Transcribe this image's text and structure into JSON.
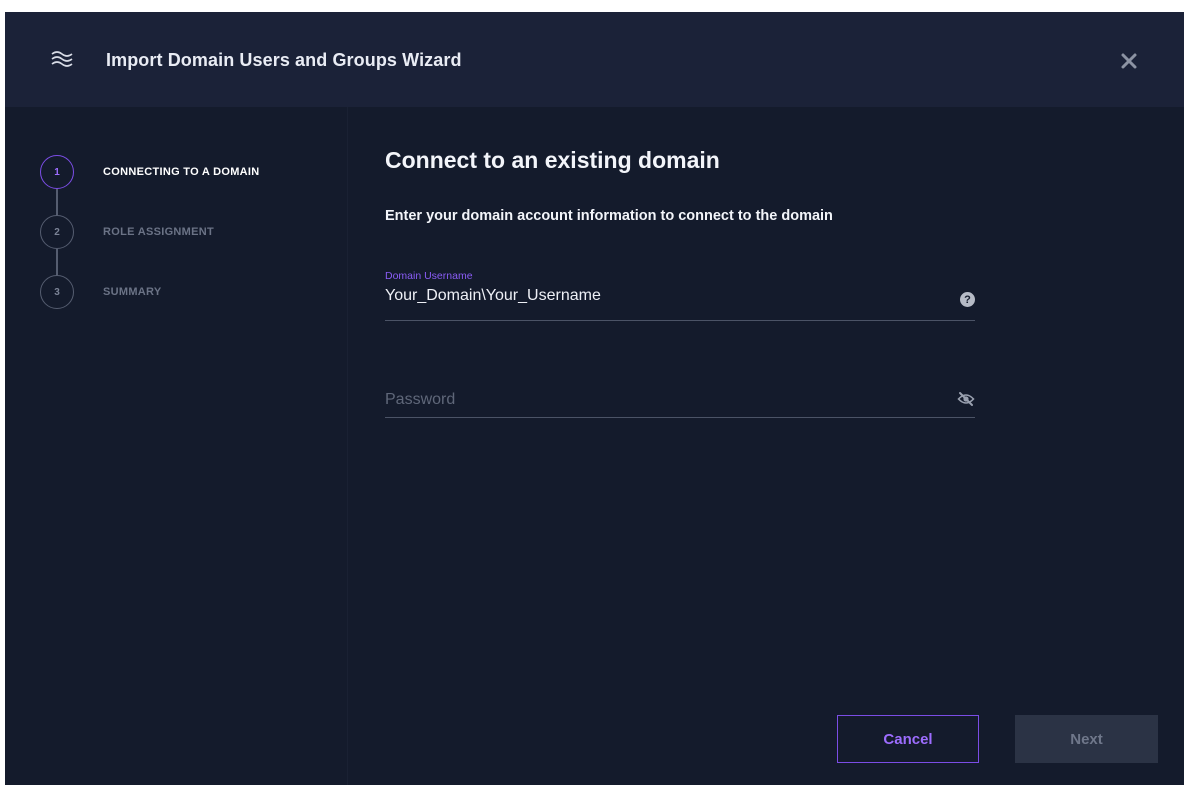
{
  "window": {
    "title": "Import Domain Users and Groups Wizard",
    "logo_icon": "waves-icon",
    "close_icon": "close-icon"
  },
  "steps": [
    {
      "number": "1",
      "label": "CONNECTING TO A DOMAIN",
      "active": true
    },
    {
      "number": "2",
      "label": "ROLE ASSIGNMENT",
      "active": false
    },
    {
      "number": "3",
      "label": "SUMMARY",
      "active": false
    }
  ],
  "main": {
    "heading": "Connect to an existing domain",
    "subheading": "Enter your domain account information to connect to the domain",
    "username": {
      "label": "Domain Username",
      "value": "Your_Domain\\Your_Username",
      "help_icon": "help-icon",
      "help_glyph": "?"
    },
    "password": {
      "placeholder": "Password",
      "value": "",
      "visibility_icon": "eye-slash-icon"
    }
  },
  "buttons": {
    "cancel": "Cancel",
    "next": "Next"
  },
  "colors": {
    "accent": "#7b4de6",
    "background": "#141b2c",
    "header": "#1b2238",
    "disabled_button": "#2b3345"
  }
}
